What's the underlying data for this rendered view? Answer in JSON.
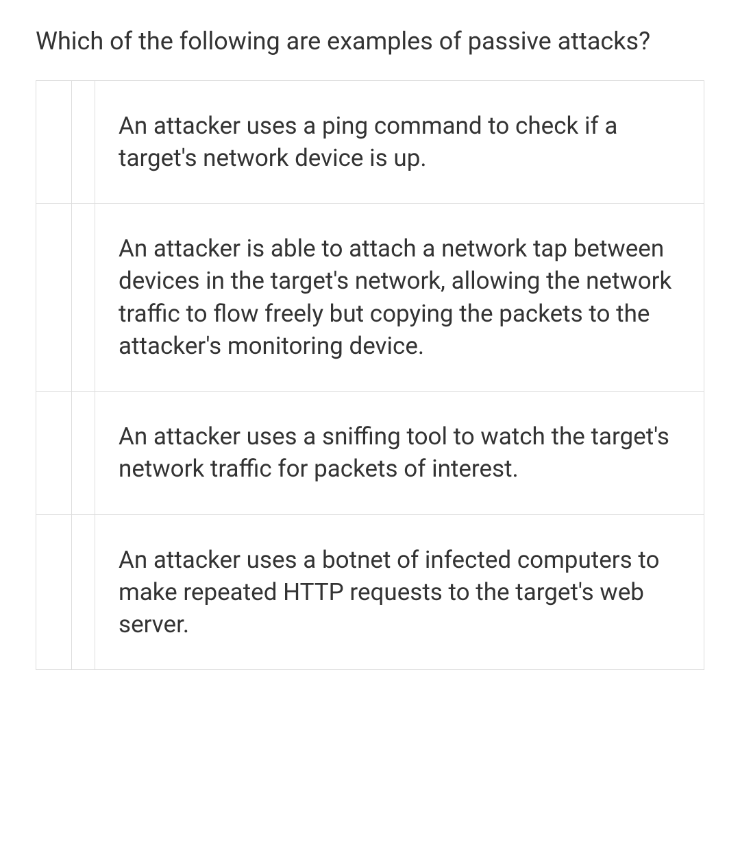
{
  "question": {
    "text": "Which of the following are examples of passive attacks?"
  },
  "options": [
    {
      "text": "An attacker uses a ping command to check if a target's network device is up."
    },
    {
      "text": "An attacker is able to attach a network tap between devices in the target's network, allowing the network traffic to flow freely but copying the packets to the attacker's monitoring device."
    },
    {
      "text": "An attacker uses a sniffing tool to watch the target's network traffic for packets of interest."
    },
    {
      "text": "An attacker uses a botnet of infected computers to make repeated HTTP requests to the target's web server."
    }
  ]
}
